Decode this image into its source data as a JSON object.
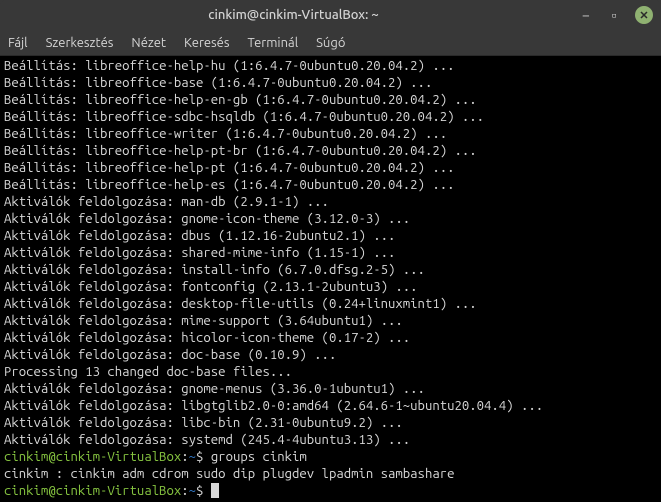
{
  "window": {
    "title": "cinkim@cinkim-VirtualBox: ~"
  },
  "menu": {
    "file": "Fájl",
    "edit": "Szerkesztés",
    "view": "Nézet",
    "search": "Keresés",
    "terminal": "Terminál",
    "help": "Súgó"
  },
  "lines": {
    "l0": "Beállítás: libreoffice-help-hu (1:6.4.7-0ubuntu0.20.04.2) ...",
    "l1": "Beállítás: libreoffice-base (1:6.4.7-0ubuntu0.20.04.2) ...",
    "l2": "Beállítás: libreoffice-help-en-gb (1:6.4.7-0ubuntu0.20.04.2) ...",
    "l3": "Beállítás: libreoffice-sdbc-hsqldb (1:6.4.7-0ubuntu0.20.04.2) ...",
    "l4": "Beállítás: libreoffice-writer (1:6.4.7-0ubuntu0.20.04.2) ...",
    "l5": "Beállítás: libreoffice-help-pt-br (1:6.4.7-0ubuntu0.20.04.2) ...",
    "l6": "Beállítás: libreoffice-help-pt (1:6.4.7-0ubuntu0.20.04.2) ...",
    "l7": "Beállítás: libreoffice-help-es (1:6.4.7-0ubuntu0.20.04.2) ...",
    "l8": "Aktiválók feldolgozása: man-db (2.9.1-1) ...",
    "l9": "Aktiválók feldolgozása: gnome-icon-theme (3.12.0-3) ...",
    "l10": "Aktiválók feldolgozása: dbus (1.12.16-2ubuntu2.1) ...",
    "l11": "Aktiválók feldolgozása: shared-mime-info (1.15-1) ...",
    "l12": "Aktiválók feldolgozása: install-info (6.7.0.dfsg.2-5) ...",
    "l13": "Aktiválók feldolgozása: fontconfig (2.13.1-2ubuntu3) ...",
    "l14": "Aktiválók feldolgozása: desktop-file-utils (0.24+linuxmint1) ...",
    "l15": "Aktiválók feldolgozása: mime-support (3.64ubuntu1) ...",
    "l16": "Aktiválók feldolgozása: hicolor-icon-theme (0.17-2) ...",
    "l17": "Aktiválók feldolgozása: doc-base (0.10.9) ...",
    "l18": "Processing 13 changed doc-base files...",
    "l19": "Aktiválók feldolgozása: gnome-menus (3.36.0-1ubuntu1) ...",
    "l20": "Aktiválók feldolgozása: libgtglib2.0-0:amd64 (2.64.6-1~ubuntu20.04.4) ...",
    "l21": "Aktiválók feldolgozása: libc-bin (2.31-0ubuntu9.2) ...",
    "l22": "Aktiválók feldolgozása: systemd (245.4-4ubuntu3.13) ...",
    "l24": "cinkim : cinkim adm cdrom sudo dip plugdev lpadmin sambashare"
  },
  "prompt": {
    "userhost": "cinkim@cinkim-VirtualBox",
    "sep": ":",
    "path": "~",
    "suffix": "$",
    "cmd1": "groups cinkim",
    "cmd2": ""
  }
}
